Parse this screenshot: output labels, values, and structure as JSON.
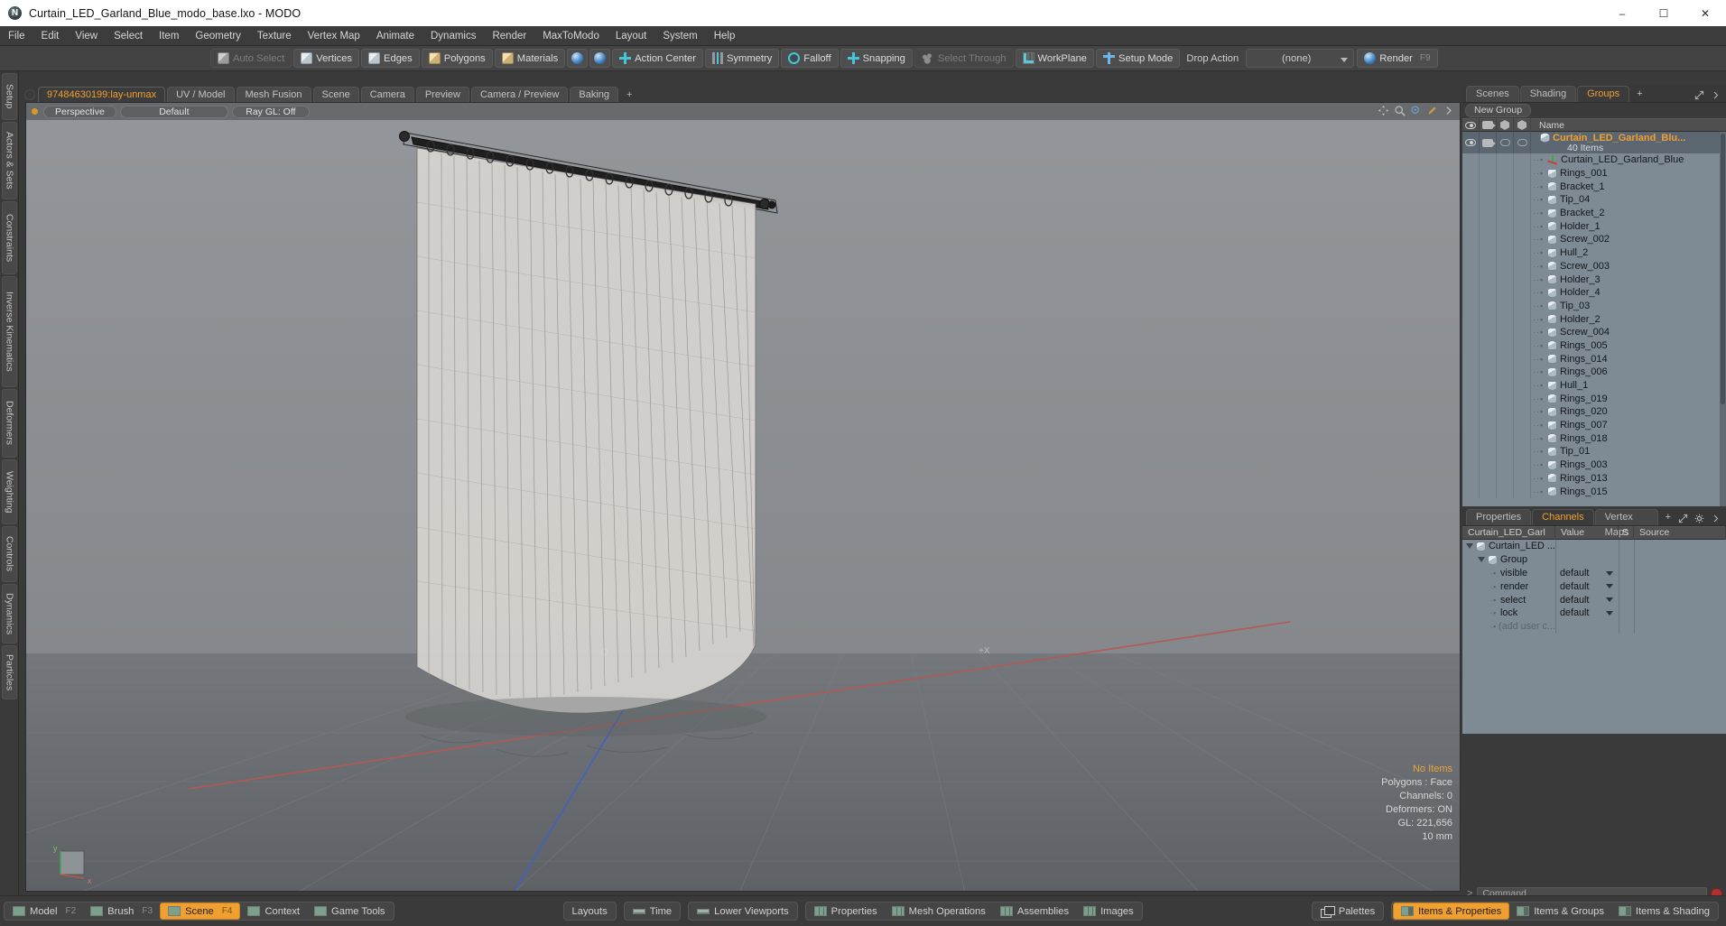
{
  "window": {
    "title": "Curtain_LED_Garland_Blue_modo_base.lxo - MODO",
    "app_icon": "modo-logo-icon",
    "minimize": "–",
    "maximize": "☐",
    "close": "✕"
  },
  "menubar": {
    "items": [
      "File",
      "Edit",
      "View",
      "Select",
      "Item",
      "Geometry",
      "Texture",
      "Vertex Map",
      "Animate",
      "Dynamics",
      "Render",
      "MaxToModo",
      "Layout",
      "System",
      "Help"
    ]
  },
  "toolbar": {
    "selection_modes": [
      {
        "label": "Auto Select",
        "icon": "cube-icon",
        "dim": true
      },
      {
        "label": "Vertices",
        "icon": "cube-icon",
        "dim": false
      },
      {
        "label": "Edges",
        "icon": "cube-icon",
        "dim": false
      },
      {
        "label": "Polygons",
        "icon": "cube-icon",
        "dim": false
      },
      {
        "label": "Materials",
        "icon": "cube-icon",
        "dim": false
      }
    ],
    "sphere_buttons": [
      "sphere-icon-1",
      "sphere-icon-2"
    ],
    "tools": [
      {
        "label": "Action Center",
        "icon": "action-center-icon"
      },
      {
        "label": "Symmetry",
        "icon": "symmetry-icon"
      },
      {
        "label": "Falloff",
        "icon": "falloff-icon"
      },
      {
        "label": "Snapping",
        "icon": "snapping-icon"
      },
      {
        "label": "Select Through",
        "icon": "select-through-icon",
        "dim": true
      },
      {
        "label": "WorkPlane",
        "icon": "workplane-icon"
      },
      {
        "label": "Setup Mode",
        "icon": "setup-mode-icon"
      }
    ],
    "drop_action_label": "Drop Action",
    "drop_action_value": "(none)",
    "render_label": "Render",
    "render_fkey": "F9"
  },
  "left_strip": {
    "tabs": [
      "Setup",
      "Actors & Sets",
      "Constraints",
      "Inverse Kinematics",
      "Deformers",
      "Weighting",
      "Controls",
      "Dynamics",
      "Particles"
    ]
  },
  "viewport_tabs": {
    "tabs": [
      {
        "label": "97484630199:lay-unmax",
        "active": true
      },
      {
        "label": "UV / Model",
        "active": false
      },
      {
        "label": "Mesh Fusion",
        "active": false
      },
      {
        "label": "Scene",
        "active": false
      },
      {
        "label": "Camera",
        "active": false
      },
      {
        "label": "Preview",
        "active": false
      },
      {
        "label": "Camera / Preview",
        "active": false
      },
      {
        "label": "Baking",
        "active": false
      }
    ],
    "add_label": "+"
  },
  "viewport": {
    "header": {
      "view_mode": "Perspective",
      "shading": "Default",
      "raygl": "Ray GL: Off"
    },
    "header_icons": [
      "move-view-icon",
      "zoom-view-icon",
      "magnify-icon",
      "pen-icon",
      "chevron-right-icon"
    ],
    "axis_gizmo": {
      "y": "y",
      "x": "x"
    },
    "stats": {
      "selection": "No Items",
      "polygons": "Polygons : Face",
      "channels": "Channels: 0",
      "deformers": "Deformers: ON",
      "gl": "GL: 221,656",
      "grid": "10 mm"
    },
    "center_marker": "+X"
  },
  "right_panel": {
    "top_tabs": [
      {
        "label": "Scenes",
        "active": false
      },
      {
        "label": "Shading",
        "active": false
      },
      {
        "label": "Groups",
        "active": true
      }
    ],
    "top_tabs_add": "+",
    "new_group_button": "New Group",
    "list_header": {
      "col_eye": "visibility-icon",
      "col_cam": "render-icon",
      "col_box1": "wireframe-icon",
      "col_box2": "shaded-icon",
      "name": "Name"
    },
    "group_root": {
      "name": "Curtain_LED_Garland_Blu...",
      "count": "40 Items",
      "icon": "mesh-icon"
    },
    "items": [
      {
        "name": "Curtain_LED_Garland_Blue",
        "icon": "locator-icon"
      },
      {
        "name": "Rings_001",
        "icon": "mesh-icon"
      },
      {
        "name": "Bracket_1",
        "icon": "mesh-icon"
      },
      {
        "name": "Tip_04",
        "icon": "mesh-icon"
      },
      {
        "name": "Bracket_2",
        "icon": "mesh-icon"
      },
      {
        "name": "Holder_1",
        "icon": "mesh-icon"
      },
      {
        "name": "Screw_002",
        "icon": "mesh-icon"
      },
      {
        "name": "Hull_2",
        "icon": "mesh-icon"
      },
      {
        "name": "Screw_003",
        "icon": "mesh-icon"
      },
      {
        "name": "Holder_3",
        "icon": "mesh-icon"
      },
      {
        "name": "Holder_4",
        "icon": "mesh-icon"
      },
      {
        "name": "Tip_03",
        "icon": "mesh-icon"
      },
      {
        "name": "Holder_2",
        "icon": "mesh-icon"
      },
      {
        "name": "Screw_004",
        "icon": "mesh-icon"
      },
      {
        "name": "Rings_005",
        "icon": "mesh-icon"
      },
      {
        "name": "Rings_014",
        "icon": "mesh-icon"
      },
      {
        "name": "Rings_006",
        "icon": "mesh-icon"
      },
      {
        "name": "Hull_1",
        "icon": "mesh-icon"
      },
      {
        "name": "Rings_019",
        "icon": "mesh-icon"
      },
      {
        "name": "Rings_020",
        "icon": "mesh-icon"
      },
      {
        "name": "Rings_007",
        "icon": "mesh-icon"
      },
      {
        "name": "Rings_018",
        "icon": "mesh-icon"
      },
      {
        "name": "Tip_01",
        "icon": "mesh-icon"
      },
      {
        "name": "Rings_003",
        "icon": "mesh-icon"
      },
      {
        "name": "Rings_013",
        "icon": "mesh-icon"
      },
      {
        "name": "Rings_015",
        "icon": "mesh-icon"
      }
    ]
  },
  "channels_panel": {
    "tabs": [
      {
        "label": "Properties",
        "active": false
      },
      {
        "label": "Channels",
        "active": true
      },
      {
        "label": "Vertex Maps",
        "active": false
      }
    ],
    "tabs_add": "+",
    "columns": [
      "Curtain_LED_Garl ...",
      "Value",
      "S",
      "Source"
    ],
    "rows": [
      {
        "name": "Curtain_LED ...",
        "value": "",
        "depth": 0,
        "icon": "mesh-icon",
        "expanded": true
      },
      {
        "name": "Group",
        "value": "",
        "depth": 1,
        "icon": "mesh-icon",
        "expanded": true
      },
      {
        "name": "visible",
        "value": "default",
        "depth": 2,
        "icon": "",
        "expanded": false
      },
      {
        "name": "render",
        "value": "default",
        "depth": 2,
        "icon": "",
        "expanded": false
      },
      {
        "name": "select",
        "value": "default",
        "depth": 2,
        "icon": "",
        "expanded": false
      },
      {
        "name": "lock",
        "value": "default",
        "depth": 2,
        "icon": "",
        "expanded": false
      },
      {
        "name": "(add user c...",
        "value": "",
        "depth": 2,
        "icon": "",
        "expanded": false,
        "dim": true
      }
    ]
  },
  "command_line": {
    "prompt": ">",
    "placeholder": "Command",
    "record_icon": "record-icon"
  },
  "bottom_bar": {
    "mode_group": [
      {
        "label": "Model",
        "fkey": "F2",
        "active": false,
        "icon": "viewport-icon"
      },
      {
        "label": "Brush",
        "fkey": "F3",
        "active": false,
        "icon": "viewport-icon"
      },
      {
        "label": "Scene",
        "fkey": "F4",
        "active": true,
        "icon": "viewport-icon"
      },
      {
        "label": "Context",
        "fkey": "",
        "active": false,
        "icon": "viewport-icon"
      },
      {
        "label": "Game Tools",
        "fkey": "",
        "active": false,
        "icon": "viewport-icon"
      }
    ],
    "layout_group": [
      {
        "label": "Layouts",
        "icon": ""
      },
      {
        "label": "Time",
        "icon": "bar-icon"
      },
      {
        "label": "Lower Viewports",
        "icon": "bar-icon"
      }
    ],
    "panel_group": [
      {
        "label": "Properties",
        "icon": "split-icon"
      },
      {
        "label": "Mesh Operations",
        "icon": "split-icon"
      },
      {
        "label": "Assemblies",
        "icon": "split-icon"
      },
      {
        "label": "Images",
        "icon": "split-icon"
      }
    ],
    "right_group": [
      {
        "label": "Palettes",
        "icon": "palettes-icon",
        "active": false
      },
      {
        "label": "Items & Properties",
        "icon": "halfw-icon",
        "active": true
      },
      {
        "label": "Items & Groups",
        "icon": "halfw-icon",
        "active": false
      },
      {
        "label": "Items & Shading",
        "icon": "halfw-icon",
        "active": false
      }
    ]
  },
  "colors": {
    "accent": "#f0a030",
    "panel_bg": "#3a3a3a",
    "list_bg": "#7e8a94",
    "viewport_sky": "#8e9194",
    "viewport_floor": "#6e7276"
  }
}
